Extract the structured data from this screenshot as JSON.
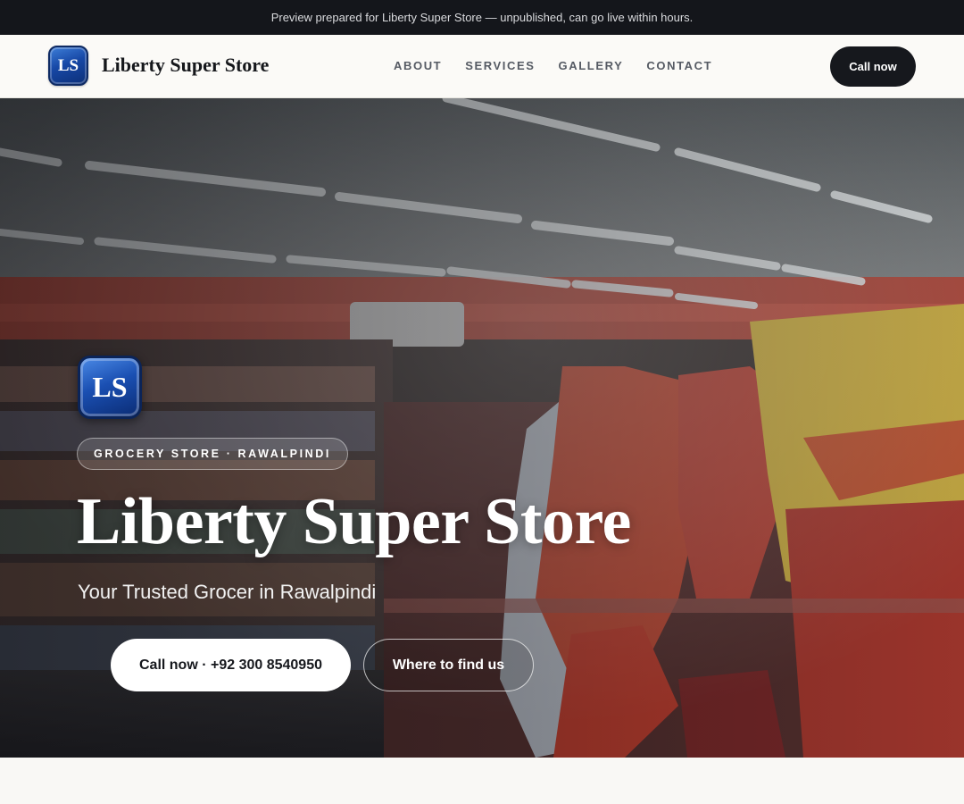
{
  "preview_banner": {
    "text": "Preview prepared for Liberty Super Store — unpublished, can go live within hours."
  },
  "header": {
    "logo_text": "LS",
    "brand": "Liberty Super Store",
    "nav": [
      "ABOUT",
      "SERVICES",
      "GALLERY",
      "CONTACT"
    ],
    "call_button": "Call now"
  },
  "hero": {
    "logo_text": "LS",
    "tag": "GROCERY STORE · RAWALPINDI",
    "title": "Liberty Super Store",
    "subtitle": "Your Trusted Grocer in Rawalpindi",
    "primary_button": "Call now · +92 300 8540950",
    "secondary_button": "Where to find us"
  },
  "colors": {
    "dark": "#14161b",
    "logo_blue": "#1748a6",
    "background": "#f9f8f5"
  }
}
